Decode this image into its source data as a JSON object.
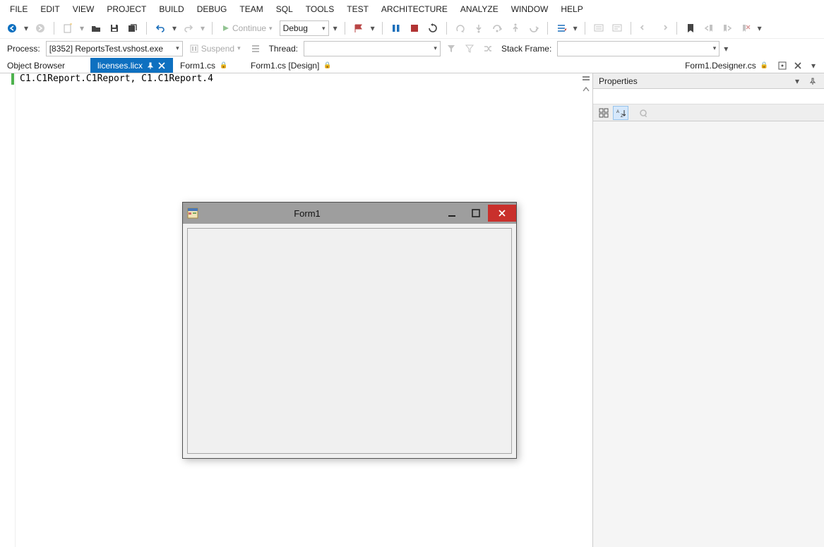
{
  "menu": {
    "items": [
      "FILE",
      "EDIT",
      "VIEW",
      "PROJECT",
      "BUILD",
      "DEBUG",
      "TEAM",
      "SQL",
      "TOOLS",
      "TEST",
      "ARCHITECTURE",
      "ANALYZE",
      "WINDOW",
      "HELP"
    ]
  },
  "toolbar1": {
    "continue_label": "Continue",
    "config_value": "Debug"
  },
  "toolbar2": {
    "process_label": "Process:",
    "process_value": "[8352] ReportsTest.vshost.exe",
    "suspend_label": "Suspend",
    "thread_label": "Thread:",
    "thread_value": "",
    "stackframe_label": "Stack Frame:",
    "stackframe_value": ""
  },
  "tabs": {
    "items": [
      {
        "label": "Object Browser",
        "active": false,
        "lock": false,
        "pin": false,
        "close": false
      },
      {
        "label": "licenses.licx",
        "active": true,
        "lock": false,
        "pin": true,
        "close": true
      },
      {
        "label": "Form1.cs",
        "active": false,
        "lock": true,
        "pin": false,
        "close": false
      },
      {
        "label": "Form1.cs [Design]",
        "active": false,
        "lock": true,
        "pin": false,
        "close": false
      },
      {
        "label": "Form1.Designer.cs",
        "active": false,
        "lock": true,
        "pin": false,
        "close": false
      }
    ]
  },
  "editor": {
    "content": "C1.C1Report.C1Report, C1.C1Report.4"
  },
  "properties": {
    "title": "Properties"
  },
  "form": {
    "title": "Form1"
  }
}
